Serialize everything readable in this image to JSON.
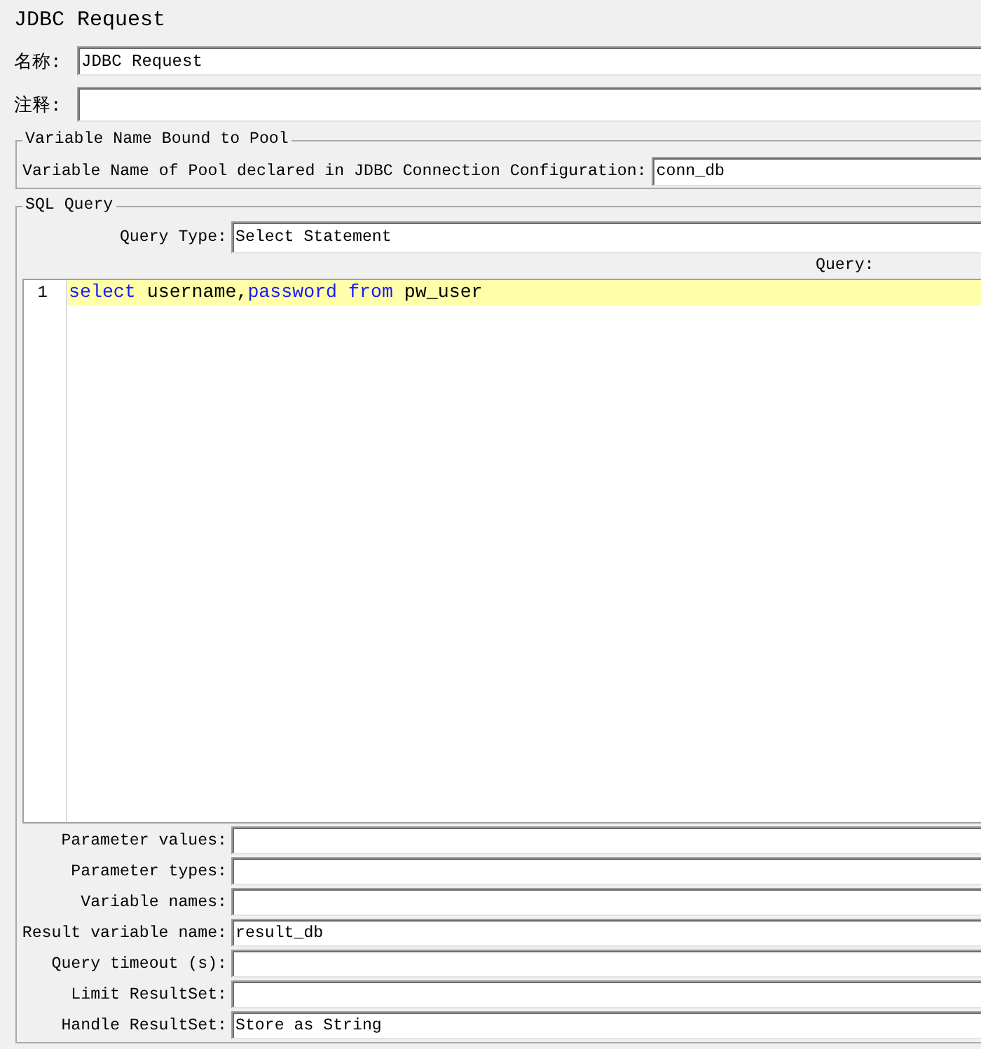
{
  "window": {
    "title": "JDBC Request"
  },
  "name_field": {
    "label": "名称:",
    "value": "JDBC Request"
  },
  "comment_field": {
    "label": "注释:"
  },
  "pool_section": {
    "title": "Variable Name Bound to Pool",
    "label": "Variable Name of Pool declared in JDBC Connection Configuration:",
    "value": "conn_db"
  },
  "sql_section": {
    "title": "SQL Query",
    "query_type": {
      "label": "Query Type:",
      "value": "Select Statement"
    },
    "query_label": "Query:",
    "editor": {
      "lines": [
        {
          "number": "1",
          "current": true,
          "tokens": [
            {
              "text": "select",
              "kind": "keyword"
            },
            {
              "text": " username,",
              "kind": "plain"
            },
            {
              "text": "password",
              "kind": "keyword"
            },
            {
              "text": " from",
              "kind": "keyword"
            },
            {
              "text": " pw_user",
              "kind": "plain"
            }
          ]
        }
      ]
    },
    "fields": [
      {
        "label": "Parameter values:"
      },
      {
        "label": "Parameter types:"
      },
      {
        "label": "Variable names:"
      },
      {
        "label": "Result variable name:",
        "value": "result_db"
      },
      {
        "label": "Query timeout (s):"
      },
      {
        "label": "Limit ResultSet:"
      },
      {
        "label": "Handle ResultSet:",
        "value": "Store as String"
      }
    ]
  }
}
